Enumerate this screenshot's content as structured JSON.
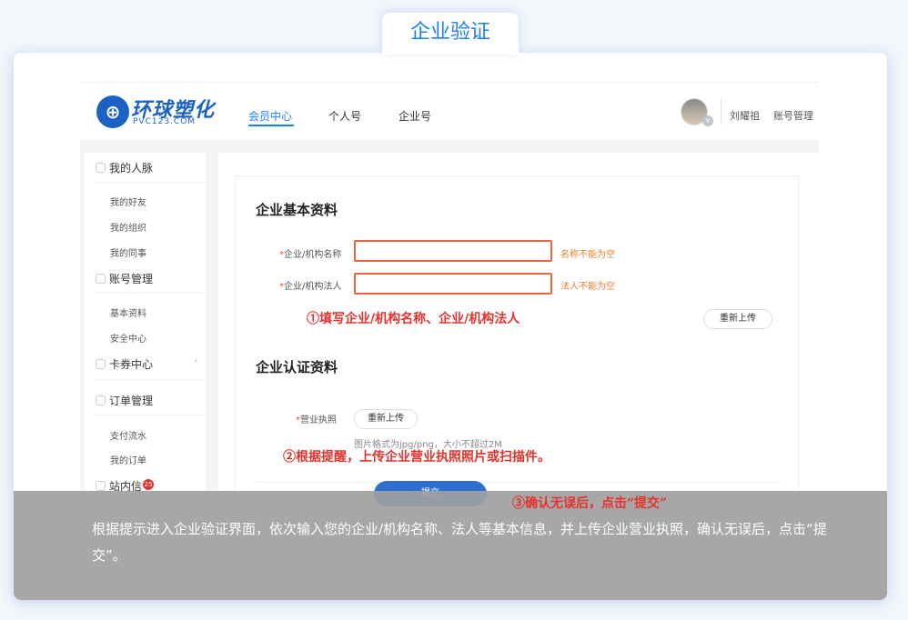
{
  "tab_title": "企业验证",
  "logo": {
    "name": "环球塑化",
    "sub": "PVC123.COM"
  },
  "nav": [
    "会员中心",
    "个人号",
    "企业号"
  ],
  "user": {
    "name": "刘耀祖",
    "account": "账号管理"
  },
  "sidebar": {
    "groups": [
      {
        "label": "我的人脉",
        "items": [
          "我的好友",
          "我的组织",
          "我的同事"
        ]
      },
      {
        "label": "账号管理",
        "items": [
          "基本资料",
          "安全中心"
        ]
      },
      {
        "label": "卡券中心",
        "items": []
      },
      {
        "label": "订单管理",
        "items": [
          "支付流水",
          "我的订单"
        ]
      },
      {
        "label": "站内信",
        "items": [],
        "badge": "25"
      }
    ]
  },
  "form": {
    "basic_title": "企业基本资料",
    "name_label": "企业/机构名称",
    "name_error": "名称不能为空",
    "legal_label": "企业/机构法人",
    "legal_error": "法人不能为空",
    "reupload": "重新上传",
    "cert_title": "企业认证资料",
    "license_label": "营业执照",
    "license_btn": "重新上传",
    "license_hint": "图片格式为jpg/png，大小不超过2M",
    "submit": "提交"
  },
  "annotations": {
    "step1": "①填写企业/机构名称、企业/机构法人",
    "step2": "②根据提醒，上传企业营业执照照片或扫描件。",
    "step3": "③确认无误后，点击“提交”"
  },
  "caption": "根据提示进入企业验证界面，依次输入您的企业/机构名称、法人等基本信息，并上传企业营业执照，确认无误后，点击“提交”。",
  "colors": {
    "accent": "#1e7ff0",
    "error": "#f0643c",
    "annotation": "#e5322d"
  }
}
